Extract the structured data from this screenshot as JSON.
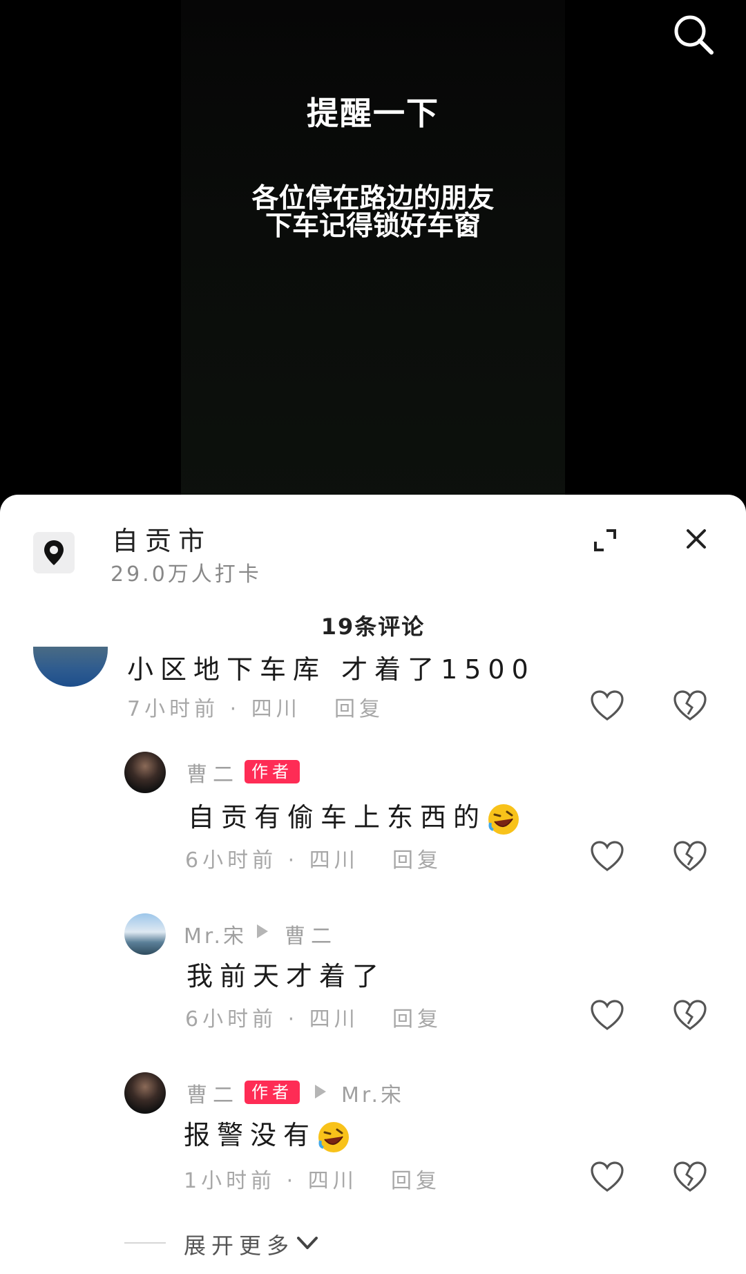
{
  "video": {
    "title": "提醒一下",
    "line1": "各位停在路边的朋友",
    "line2": "下车记得锁好车窗"
  },
  "panel": {
    "location_name": "自贡市",
    "location_count": "29.0万人打卡",
    "comment_count": "19条评论",
    "expand_more": "展开更多"
  },
  "comments": [
    {
      "text": "小区地下车库 才着了1500",
      "time": "7小时前 · 四川",
      "reply": "回复"
    },
    {
      "user": "曹二",
      "badge": "作者",
      "text": "自贡有偷车上东西的",
      "time": "6小时前 · 四川",
      "reply": "回复"
    },
    {
      "user": "Mr.宋",
      "reply_to": "曹二",
      "text": "我前天才着了",
      "time": "6小时前 · 四川",
      "reply": "回复"
    },
    {
      "user": "曹二",
      "badge": "作者",
      "reply_to": "Mr.宋",
      "text": "报警没有",
      "time": "1小时前 · 四川",
      "reply": "回复"
    }
  ],
  "icons": {
    "search": "search-icon",
    "location": "location-pin-icon",
    "expand": "expand-icon",
    "close": "close-icon",
    "like": "heart-icon",
    "dislike": "broken-heart-icon",
    "emoji": "rolling-laughing-emoji",
    "chevron": "chevron-down-icon"
  },
  "colors": {
    "badge": "#fe2c55",
    "sheet": "#ffffff",
    "video_bg": "#000000"
  }
}
